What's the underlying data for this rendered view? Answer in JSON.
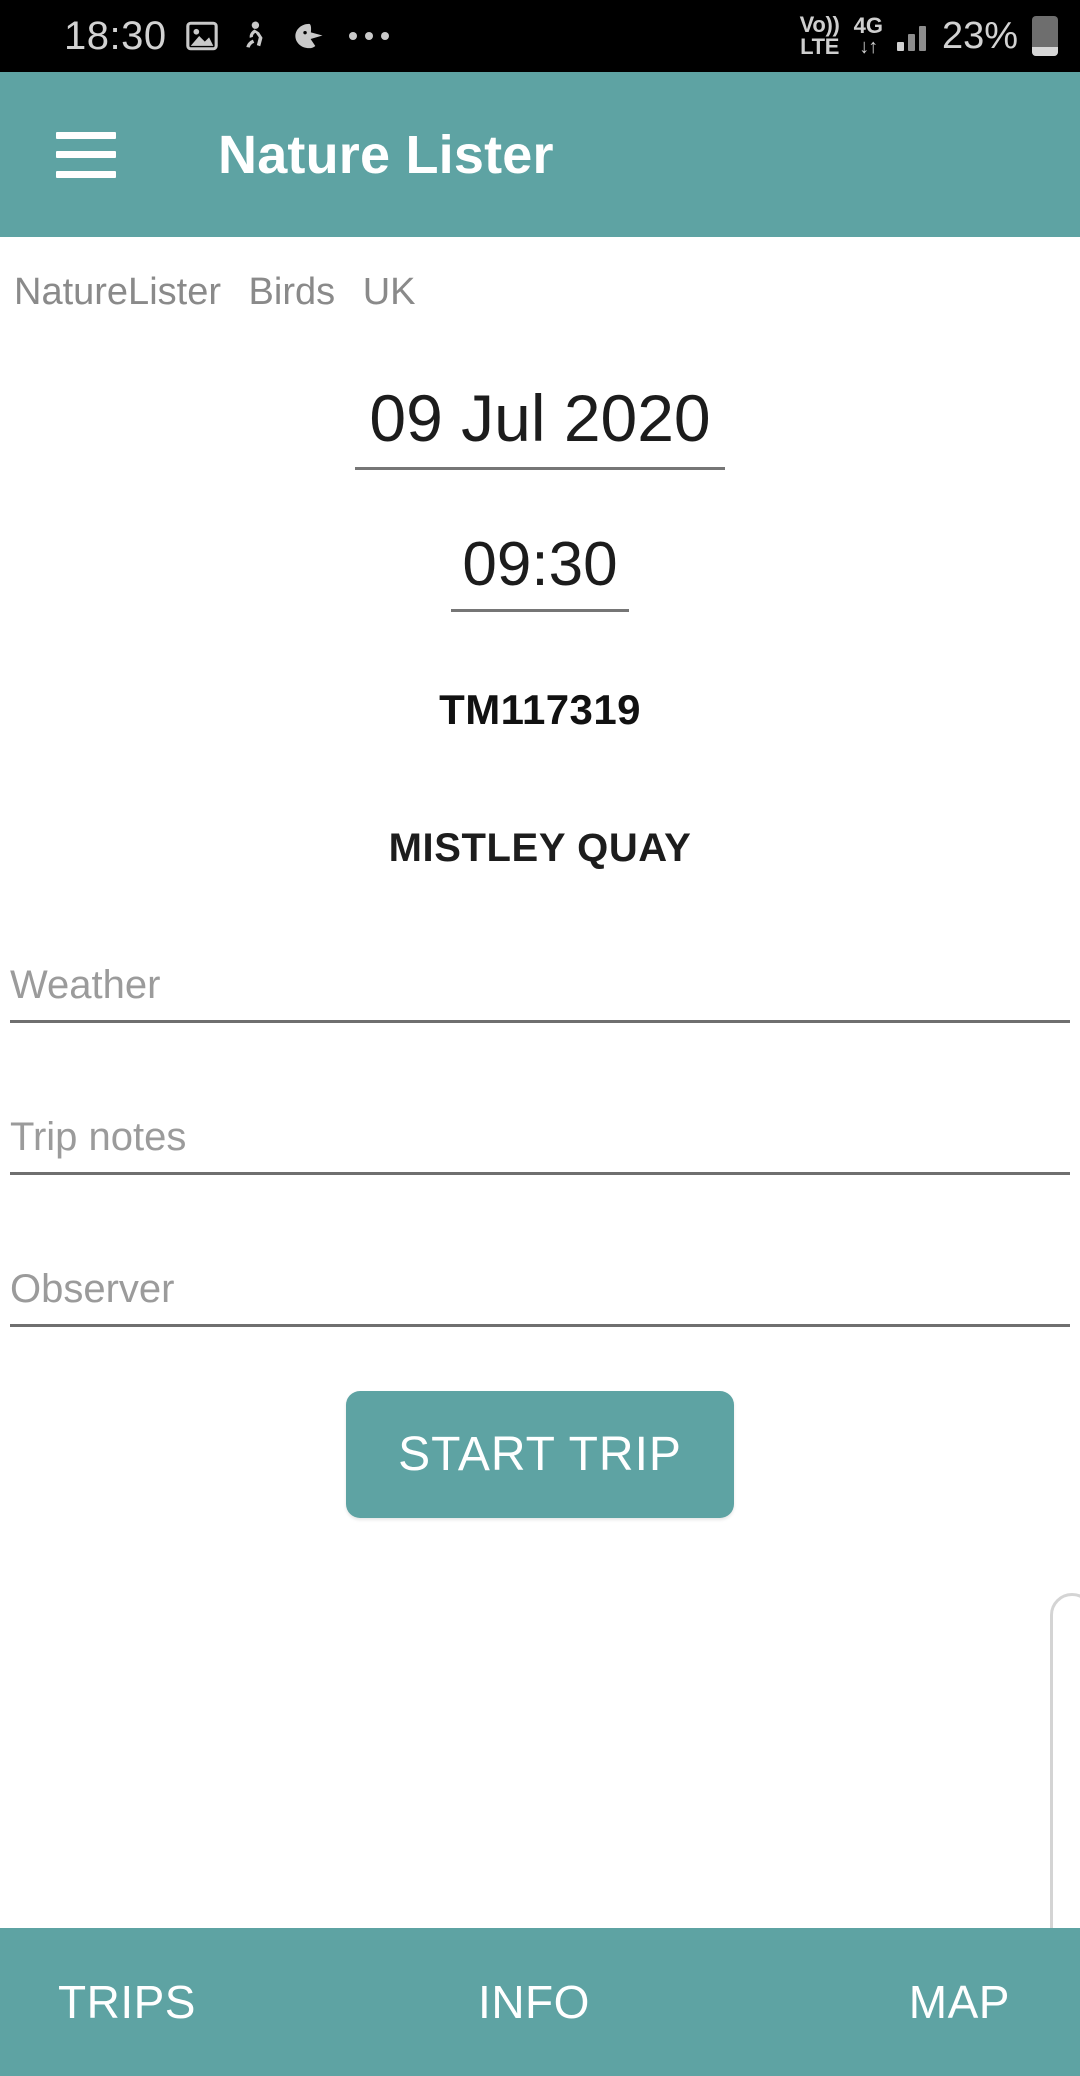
{
  "status_bar": {
    "clock": "18:30",
    "icons": [
      "image-icon",
      "person-icon",
      "bird-icon",
      "more-dots-icon"
    ],
    "volte": "Vo))",
    "volte_second": "LTE",
    "network": "4G",
    "network_arrows": "↓↑",
    "battery_percent": "23%",
    "battery_level": 23
  },
  "app_bar": {
    "menu_icon": "hamburger-icon",
    "title": "Nature Lister"
  },
  "breadcrumb": {
    "items": [
      "NatureLister",
      "Birds",
      "UK"
    ]
  },
  "trip_form": {
    "date": "09 Jul 2020",
    "time": "09:30",
    "grid_reference": "TM117319",
    "site_name": "MISTLEY QUAY",
    "fields": [
      {
        "name": "weather",
        "value": "",
        "placeholder": "Weather"
      },
      {
        "name": "trip-notes",
        "value": "",
        "placeholder": "Trip notes"
      },
      {
        "name": "observer",
        "value": "",
        "placeholder": "Observer"
      }
    ],
    "start_button": "START TRIP"
  },
  "bottom_nav": {
    "items": [
      {
        "label": "TRIPS"
      },
      {
        "label": "INFO"
      },
      {
        "label": "MAP"
      }
    ]
  },
  "colors": {
    "accent_teal": "#5ea3a3",
    "status_bar_bg": "#000000",
    "text_primary": "#1c1c1c",
    "text_muted": "#8a8a8a",
    "placeholder": "#9b9b9b",
    "underline": "#6f6f6f"
  }
}
